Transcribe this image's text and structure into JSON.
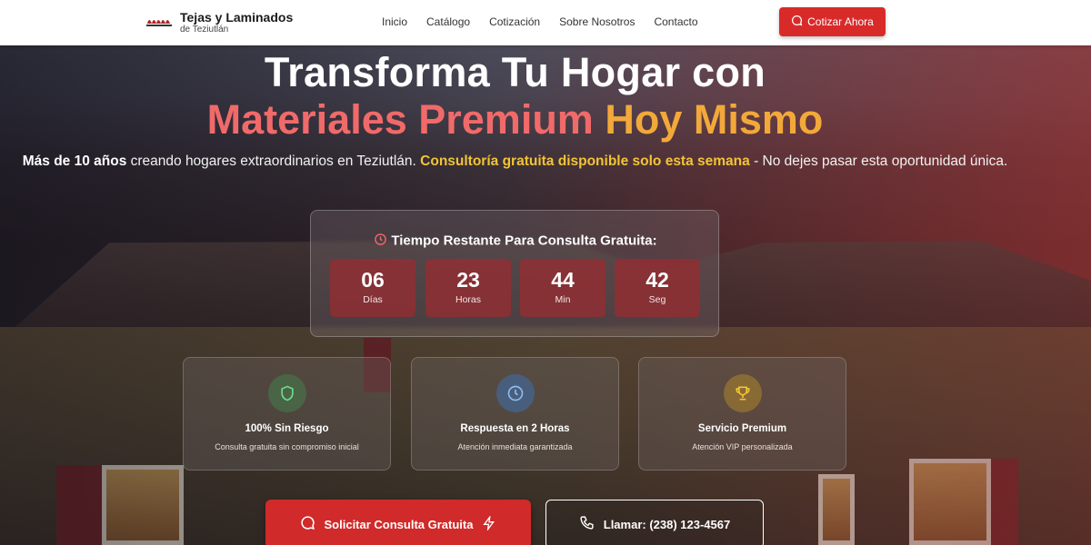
{
  "header": {
    "brand_name": "Tejas y Laminados",
    "brand_sub": "de Teziutlán",
    "nav": [
      "Inicio",
      "Catálogo",
      "Cotización",
      "Sobre Nosotros",
      "Contacto"
    ],
    "cta": "Cotizar Ahora"
  },
  "hero": {
    "title_line1": "Transforma Tu Hogar con",
    "title_line2_a": "Materiales Premium",
    "title_line2_b": "Hoy Mismo",
    "subtitle_bold": "Más de 10 años",
    "subtitle_mid": " creando hogares extraordinarios en Teziutlán. ",
    "subtitle_highlight": "Consultoría gratuita disponible solo esta semana",
    "subtitle_end": " - No dejes pasar esta oportunidad única."
  },
  "countdown": {
    "heading": "Tiempo Restante Para Consulta Gratuita:",
    "units": [
      {
        "value": "06",
        "label": "Días"
      },
      {
        "value": "23",
        "label": "Horas"
      },
      {
        "value": "44",
        "label": "Min"
      },
      {
        "value": "42",
        "label": "Seg"
      }
    ]
  },
  "features": [
    {
      "icon": "shield-icon",
      "title": "100% Sin Riesgo",
      "desc": "Consulta gratuita sin compromiso inicial",
      "color": "#3f9d54"
    },
    {
      "icon": "clock-icon",
      "title": "Respuesta en 2 Horas",
      "desc": "Atención inmediata garantizada",
      "color": "#3a78c8"
    },
    {
      "icon": "trophy-icon",
      "title": "Servicio Premium",
      "desc": "Atención VIP personalizada",
      "color": "#d9a520"
    }
  ],
  "actions": {
    "primary": "Solicitar Consulta Gratuita",
    "secondary": "Llamar: (238) 123-4567"
  },
  "colors": {
    "accent_red": "#d92a2a",
    "highlight_yellow": "#f2c434"
  }
}
